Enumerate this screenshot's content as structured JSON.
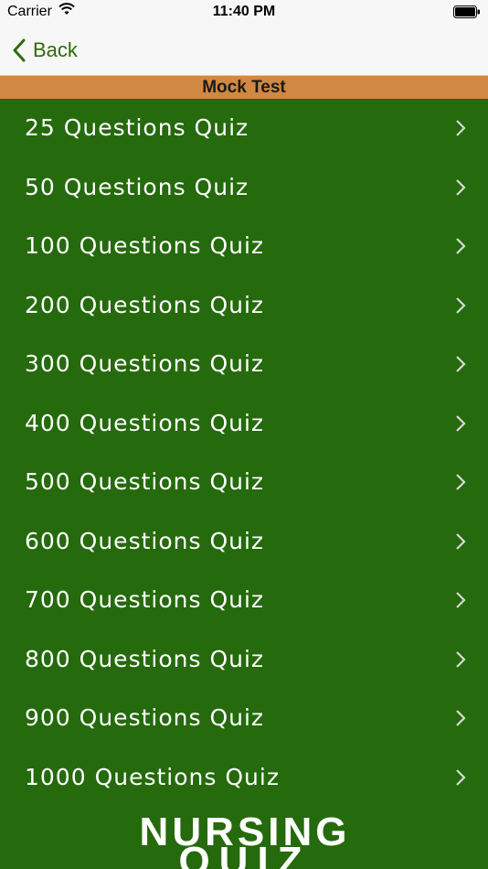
{
  "status_bar": {
    "carrier": "Carrier",
    "time": "11:40 PM",
    "wifi_icon": "wifi-icon",
    "battery_icon": "battery-icon"
  },
  "nav": {
    "back_label": "Back",
    "back_icon": "chevron-left-icon",
    "accent": "#2f6b0a"
  },
  "section": {
    "title": "Mock Test",
    "color": "#d08842"
  },
  "list": {
    "background": "#256a0c",
    "chevron_icon": "chevron-right-icon",
    "items": [
      "25 Questions Quiz",
      "50 Questions Quiz",
      "100 Questions Quiz",
      "200 Questions Quiz",
      "300 Questions Quiz",
      "400 Questions Quiz",
      "500 Questions Quiz",
      "600 Questions Quiz",
      "700 Questions Quiz",
      "800 Questions Quiz",
      "900 Questions Quiz",
      "1000 Questions Quiz"
    ]
  },
  "logo": {
    "line1": "NURSING",
    "line2": "QUIZ"
  }
}
